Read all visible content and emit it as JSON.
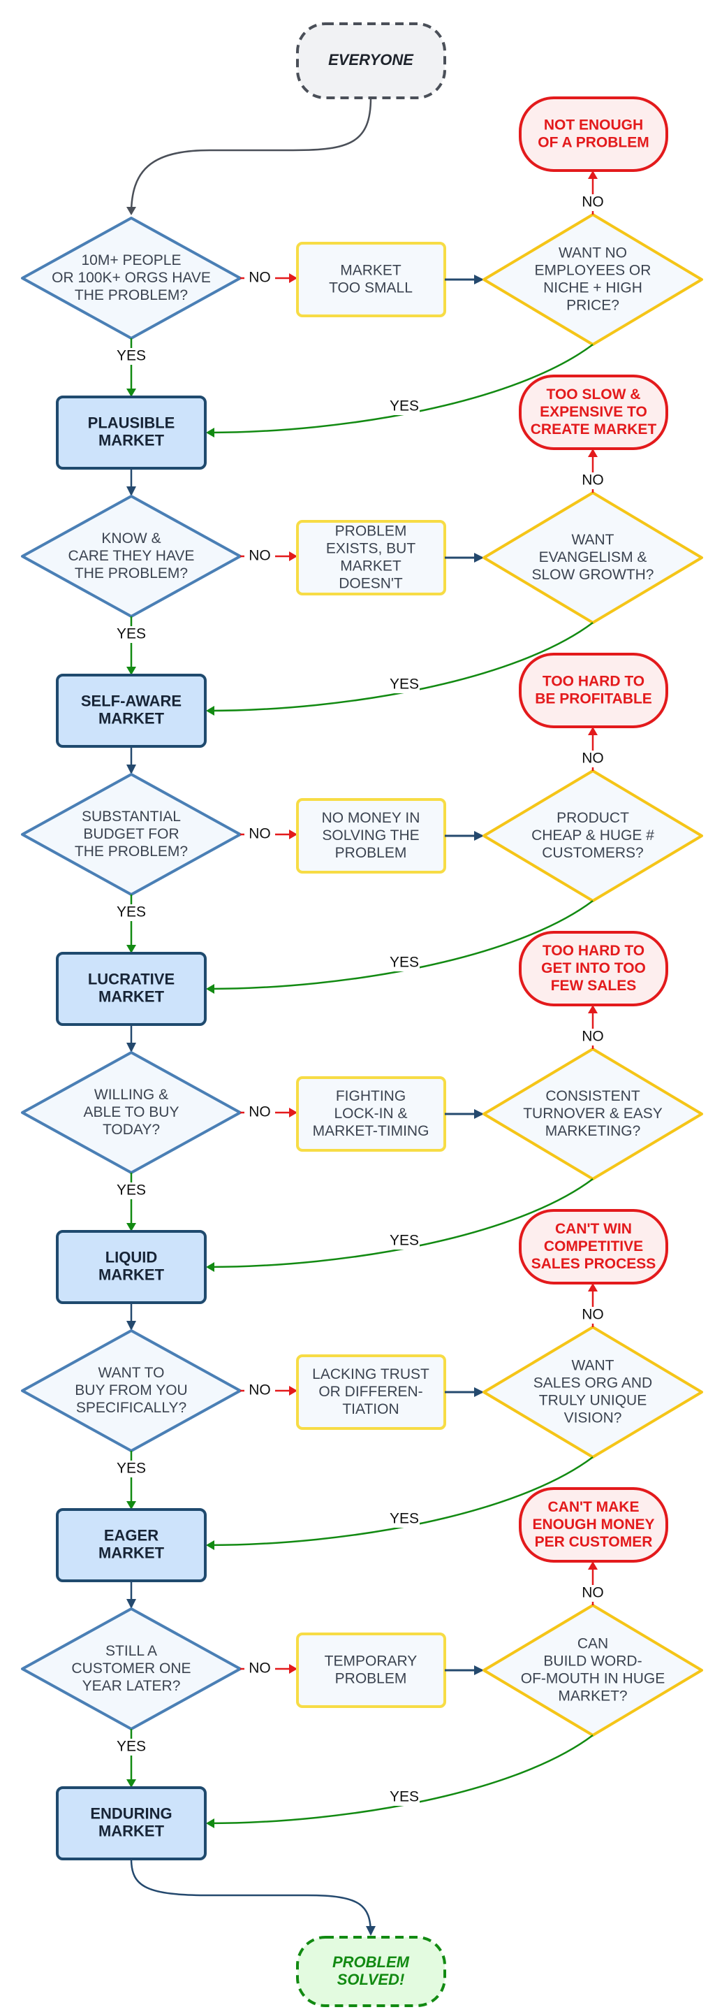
{
  "start": {
    "label": "EVERYONE"
  },
  "end": {
    "label": "PROBLEM SOLVED!"
  },
  "labels": {
    "yes": "YES",
    "no": "NO"
  },
  "colors": {
    "question": "#4a7fb5",
    "warning": "#f5c518",
    "fail": "#e31a1c",
    "market": "#1f4a6e",
    "yes": "#128a12",
    "success": "#128a12"
  },
  "rows": [
    {
      "question": [
        "10M+ PEOPLE",
        "OR 100K+ ORGS HAVE",
        "THE PROBLEM?"
      ],
      "no_box": [
        "MARKET",
        "TOO SMALL"
      ],
      "alt_question": [
        "WANT NO",
        "EMPLOYEES OR",
        "NICHE + HIGH",
        "PRICE?"
      ],
      "outcome": [
        "NOT ENOUGH",
        "OF A PROBLEM"
      ],
      "market": [
        "PLAUSIBLE",
        "MARKET"
      ]
    },
    {
      "question": [
        "KNOW &",
        "CARE THEY HAVE",
        "THE PROBLEM?"
      ],
      "no_box": [
        "PROBLEM",
        "EXISTS, BUT",
        "MARKET",
        "DOESN'T"
      ],
      "alt_question": [
        "WANT",
        "EVANGELISM &",
        "SLOW GROWTH?"
      ],
      "outcome": [
        "TOO SLOW &",
        "EXPENSIVE TO",
        "CREATE MARKET"
      ],
      "market": [
        "SELF-AWARE",
        "MARKET"
      ]
    },
    {
      "question": [
        "SUBSTANTIAL",
        "BUDGET FOR",
        "THE PROBLEM?"
      ],
      "no_box": [
        "NO MONEY IN",
        "SOLVING THE",
        "PROBLEM"
      ],
      "alt_question": [
        "PRODUCT",
        "CHEAP & HUGE #",
        "CUSTOMERS?"
      ],
      "outcome": [
        "TOO HARD TO",
        "BE PROFITABLE"
      ],
      "market": [
        "LUCRATIVE",
        "MARKET"
      ]
    },
    {
      "question": [
        "WILLING &",
        "ABLE TO BUY",
        "TODAY?"
      ],
      "no_box": [
        "FIGHTING",
        "LOCK-IN &",
        "MARKET-TIMING"
      ],
      "alt_question": [
        "CONSISTENT",
        "TURNOVER & EASY",
        "MARKETING?"
      ],
      "outcome": [
        "TOO HARD TO",
        "GET INTO TOO",
        "FEW SALES"
      ],
      "market": [
        "LIQUID",
        "MARKET"
      ]
    },
    {
      "question": [
        "WANT TO",
        "BUY FROM YOU",
        "SPECIFICALLY?"
      ],
      "no_box": [
        "LACKING TRUST",
        "OR DIFFEREN-",
        "TIATION"
      ],
      "alt_question": [
        "WANT",
        "SALES ORG AND",
        "TRULY UNIQUE",
        "VISION?"
      ],
      "outcome": [
        "CAN'T WIN",
        "COMPETITIVE",
        "SALES PROCESS"
      ],
      "market": [
        "EAGER",
        "MARKET"
      ]
    },
    {
      "question": [
        "STILL A",
        "CUSTOMER ONE",
        "YEAR LATER?"
      ],
      "no_box": [
        "TEMPORARY",
        "PROBLEM"
      ],
      "alt_question": [
        "CAN",
        "BUILD WORD-",
        "OF-MOUTH IN HUGE",
        "MARKET?"
      ],
      "outcome": [
        "CAN'T MAKE",
        "ENOUGH MONEY",
        "PER CUSTOMER"
      ],
      "market": [
        "ENDURING",
        "MARKET"
      ]
    }
  ]
}
